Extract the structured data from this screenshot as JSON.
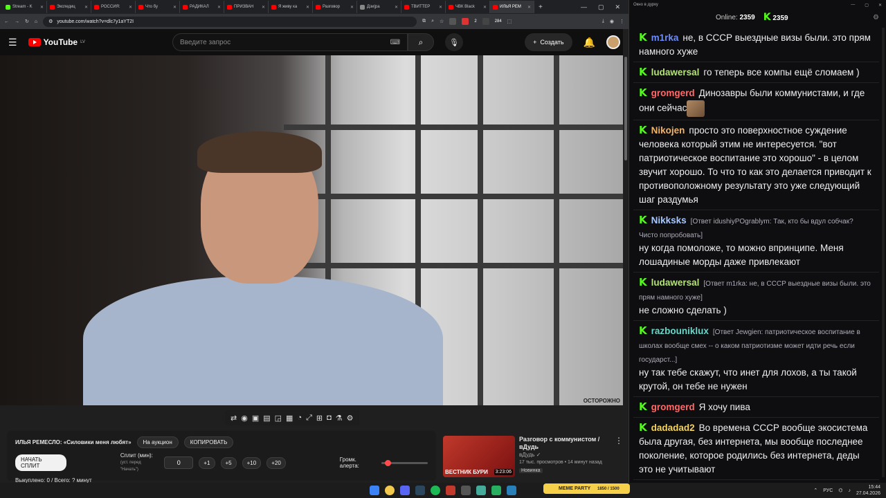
{
  "browser": {
    "tabs": [
      {
        "title": "Stream - K",
        "color": "#53fc18"
      },
      {
        "title": "Экспедиц",
        "color": "#ff0000"
      },
      {
        "title": "РОССИЯ:",
        "color": "#ff0000"
      },
      {
        "title": "Что бу",
        "color": "#ff0000"
      },
      {
        "title": "РАДИКАЛ",
        "color": "#ff0000"
      },
      {
        "title": "ПРИЗВАН",
        "color": "#ff0000"
      },
      {
        "title": "Я живу ка",
        "color": "#ff0000"
      },
      {
        "title": "Разговор",
        "color": "#ff0000"
      },
      {
        "title": "Дзи|ра",
        "color": "#888888"
      },
      {
        "title": "ТВИТТЕР",
        "color": "#ff0000"
      },
      {
        "title": "ЧВК Black",
        "color": "#ff0000"
      },
      {
        "title": "ИЛЬЯ РЕМ",
        "color": "#ff0000"
      }
    ],
    "url": "youtube.com/watch?v=dlc7y1aYT2I",
    "ext_badge_1": "2",
    "ext_badge_2": "284"
  },
  "youtube": {
    "logo": "YouTube",
    "region": "LV",
    "search_placeholder": "Введите запрос",
    "create_label": "Создать"
  },
  "video": {
    "watermark": "ОСТОРОЖНО"
  },
  "auction": {
    "title": "ИЛЬЯ РЕМЕСЛО: «Силовики меня любят»",
    "to_auction": "На аукцион",
    "copy": "КОПИРОВАТЬ",
    "start_split": "НАЧАТЬ СПЛИТ",
    "split_label": "Сплит (мин):",
    "split_hint": "(уст. перед \"Начать\")",
    "split_value": "0",
    "increments": [
      "+1",
      "+5",
      "+10",
      "+20"
    ],
    "alert_volume": "Громк. алерта:",
    "bought": "Выкуплено: 0 / Всего: ? минут",
    "alert_volume_level": 0.07
  },
  "recommended": {
    "title": "Разговор с коммунистом / вДудь",
    "channel": "вДудь",
    "stats": "17 тыс. просмотров • 14 минут назад",
    "badge": "Новинка",
    "duration": "3:23:06",
    "thumb_caption": "ВЕСТНИК БУРИ"
  },
  "chat": {
    "window_title": "Окно в дурку",
    "online_label": "Online:",
    "online_count": "2359",
    "viewers_count": "2359",
    "messages": [
      {
        "user": "m1rka",
        "color": "#6e8cf7",
        "text": "не, в СССР выездные визы были. это прям намного хуже"
      },
      {
        "user": "ludawersal",
        "color": "#b5e27b",
        "text": "го теперь все компы ещё сломаем )"
      },
      {
        "user": "gromgerd",
        "color": "#ff6b6b",
        "text": "Динозавры были коммунистами, и где они сейчас",
        "emote": true
      },
      {
        "user": "Nikojen",
        "color": "#f0b46a",
        "text": "просто это поверхностное суждение человека который этим не интересуется. \"вот патриотическое воспитание это хорошо\" - в целом звучит хорошо. То что то как это делается приводит к противоположному результату это уже следующий шаг раздумья"
      },
      {
        "user": "Nikksks",
        "color": "#a8c8ff",
        "reply": "[Ответ idushiyPOgrablym: Так, кто бы вдул собчак? Чисто попробовать]",
        "text": "ну когда помоложе, то можно впринципе. Меня лошадиные морды даже привлекают"
      },
      {
        "user": "ludawersal",
        "color": "#b5e27b",
        "reply": "[Ответ m1rka: не, в СССР выездные визы были. это прям намного хуже]",
        "text": "не сложно сделать )"
      },
      {
        "user": "razbouniklux",
        "color": "#6ad6c8",
        "reply": "[Ответ Jewgien: патриотическое воспитание в школах вообще смех -- о каком патриотизме может идти речь если государст...]",
        "text": "ну так тебе скажут, что инет для лохов, а ты такой крутой, он тебе не нужен"
      },
      {
        "user": "gromgerd",
        "color": "#ff6b6b",
        "text": "Я хочу пива"
      },
      {
        "user": "dadadad2",
        "color": "#f4d35e",
        "text": "Во времена СССР вообще экосистема была другая, без интернета, мы вообще последнее поколение, которое родились без интернета, деды это не учитывают"
      }
    ]
  },
  "taskbar": {
    "meme_party": "MEME PARTY",
    "meme_progress": "1850 / 1500",
    "lang": "РУС",
    "time": "15:44",
    "date": "27.04.2026"
  },
  "colors": {
    "kick_green": "#53fc18",
    "youtube_red": "#ff0000"
  }
}
